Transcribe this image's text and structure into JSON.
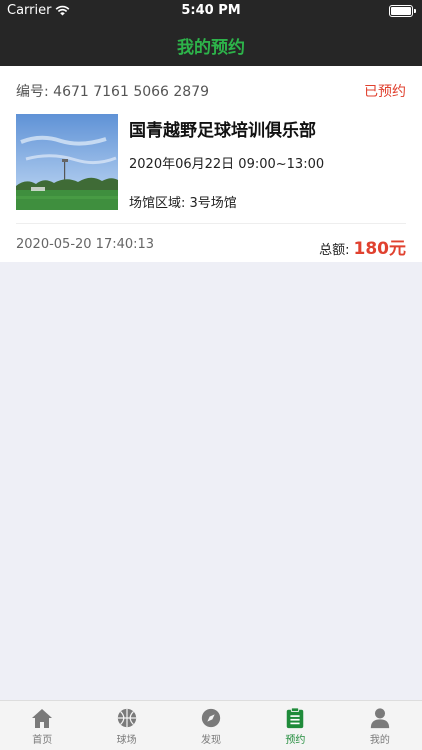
{
  "status_bar": {
    "carrier": "Carrier",
    "time": "5:40 PM"
  },
  "nav": {
    "title": "我的预约"
  },
  "order": {
    "number": "编号: 4671 7161 5066 2879",
    "status": "已预约",
    "venue_name": "国青越野足球培训俱乐部",
    "date_time": "2020年06月22日   09:00~13:00",
    "area": "场馆区域:  3号场馆",
    "created_at": "2020-05-20 17:40:13",
    "total_label": "总额:",
    "total_amount": "180元"
  },
  "tabs": [
    {
      "label": "首页",
      "icon": "home-icon"
    },
    {
      "label": "球场",
      "icon": "basketball-icon"
    },
    {
      "label": "发现",
      "icon": "compass-icon"
    },
    {
      "label": "预约",
      "icon": "clipboard-icon"
    },
    {
      "label": "我的",
      "icon": "user-icon"
    }
  ],
  "colors": {
    "accent": "#2db34a",
    "price": "#e0412f",
    "active_tab": "#1f8b3a"
  }
}
